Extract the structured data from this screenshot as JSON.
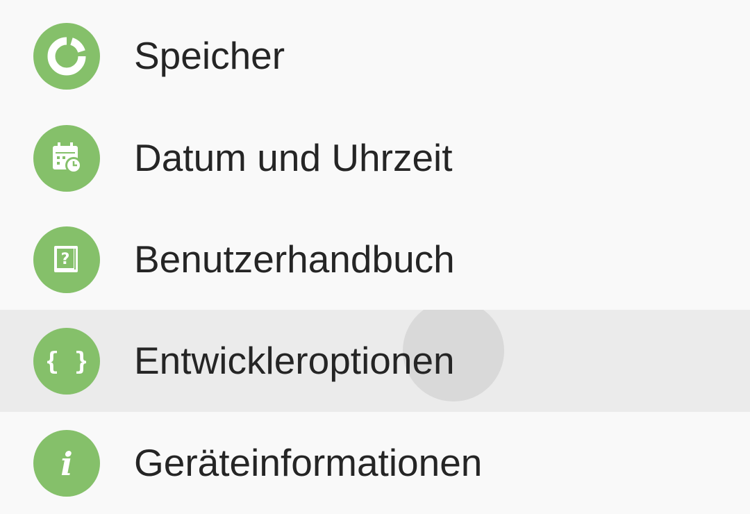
{
  "settings_list": {
    "items": [
      {
        "label": "Speicher",
        "icon": "storage-icon"
      },
      {
        "label": "Datum und Uhrzeit",
        "icon": "date-time-icon"
      },
      {
        "label": "Benutzerhandbuch",
        "icon": "user-manual-icon"
      },
      {
        "label": "Entwickleroptionen",
        "icon": "developer-options-icon",
        "pressed": true
      },
      {
        "label": "Geräteinformationen",
        "icon": "device-info-icon"
      }
    ],
    "icon_color": "#85c06a",
    "pressed_row_color": "#ebebeb",
    "ripple_color": "#d9d9d9",
    "background_color": "#f9f9f9"
  }
}
